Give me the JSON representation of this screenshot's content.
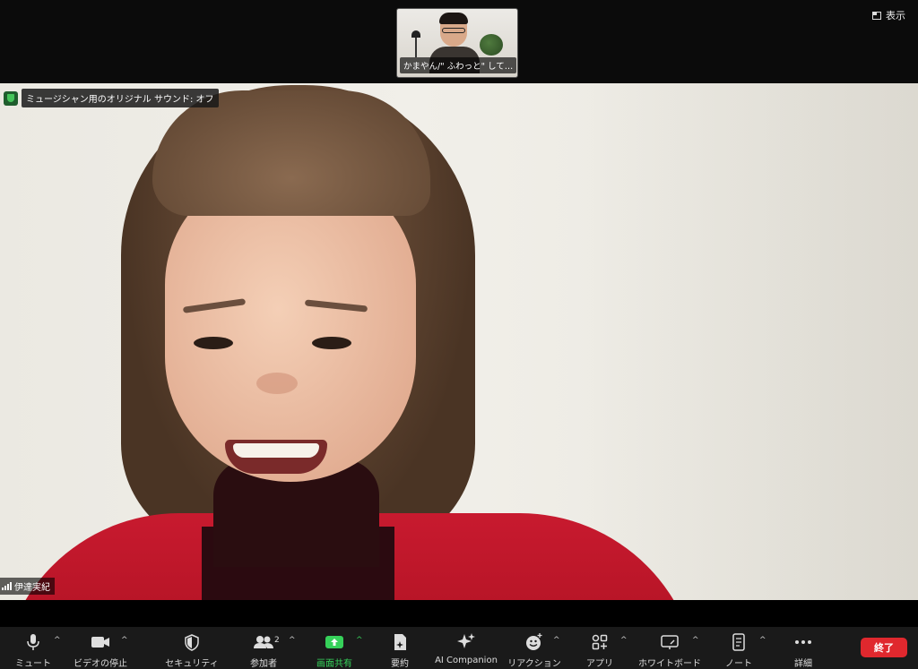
{
  "top": {
    "view_label": "表示",
    "thumbnail_name": "かまやん/\" ふわっと\" して…"
  },
  "main": {
    "sound_status": "ミュージシャン用のオリジナル サウンド: オフ",
    "speaker_name": "伊達実紀"
  },
  "toolbar": {
    "mute": "ミュート",
    "video": "ビデオの停止",
    "security": "セキュリティ",
    "participants": "参加者",
    "participants_count": "2",
    "share": "画面共有",
    "summary": "要約",
    "ai": "AI Companion",
    "reactions": "リアクション",
    "apps": "アプリ",
    "whiteboard": "ホワイトボード",
    "notes": "ノート",
    "more": "詳細",
    "end": "終了"
  },
  "colors": {
    "share_green": "#36d15a",
    "end_red": "#e0282e",
    "toolbar_bg": "#1a1a1a"
  }
}
